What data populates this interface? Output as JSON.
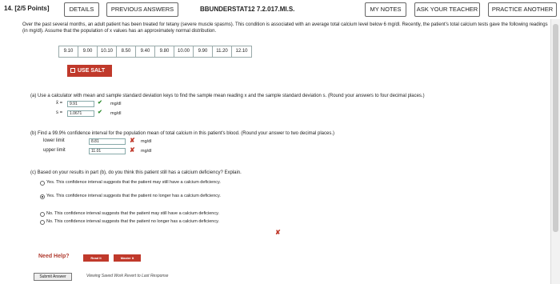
{
  "header": {
    "question_number": "14.",
    "points": "[2/5 Points]",
    "details_label": "DETAILS",
    "previous_answers_label": "PREVIOUS ANSWERS",
    "question_id": "BBUNDERSTAT12 7.2.017.MI.S.",
    "my_notes_label": "MY NOTES",
    "ask_teacher_label": "ASK YOUR TEACHER",
    "practice_label": "PRACTICE ANOTHER"
  },
  "intro_text": "Over the past several months, an adult patient has been treated for tetany (severe muscle spasms). This condition is associated with an average total calcium level below 6 mg/dl. Recently, the patient's total calcium tests gave the following readings (in mg/dl). Assume that the population of x values has an approximately normal distribution.",
  "readings": [
    "9.10",
    "9.00",
    "10.10",
    "8.50",
    "9.40",
    "9.80",
    "10.00",
    "9.90",
    "11.20",
    "12.10"
  ],
  "salt_label": "USE SALT",
  "part_a": {
    "text": "(a)  Use a calculator with mean and sample standard deviation keys to find the sample mean reading x and the sample standard deviation s. (Round your answers to four decimal places.)",
    "xbar_label": "x̄ =",
    "xbar_value": "9.91",
    "xbar_unit": "mg/dl",
    "s_label": "s =",
    "s_value": "1.0671",
    "s_unit": "mg/dl"
  },
  "part_b": {
    "text": "(b)  Find a 99.9% confidence interval for the population mean of total calcium in this patient's blood. (Round your answer to two decimal places.)",
    "lower_label": "lower limit",
    "lower_value": "8.81",
    "upper_label": "upper limit",
    "upper_value": "11.01",
    "unit": "mg/dl"
  },
  "part_c": {
    "text": "(c)  Based on your results in part (b), do you think this patient still has a calcium deficiency? Explain.",
    "options": [
      "Yes. This confidence interval suggests that the patient may still have a calcium deficiency.",
      "Yes. This confidence interval suggests that the patient no longer has a calcium deficiency.",
      "No. This confidence interval suggests that the patient may still have a calcium deficiency.",
      "No. This confidence interval suggests that the patient no longer has a calcium deficiency."
    ],
    "selected_index": 1
  },
  "help": {
    "label": "Need Help?",
    "read_it": "Read It",
    "master_it": "Master It"
  },
  "footer": {
    "submit_label": "Submit Answer",
    "links": "Viewing Saved Work Revert to Last Response"
  },
  "colors": {
    "accent_red": "#c0392b",
    "check_green": "#2e8b2e"
  }
}
